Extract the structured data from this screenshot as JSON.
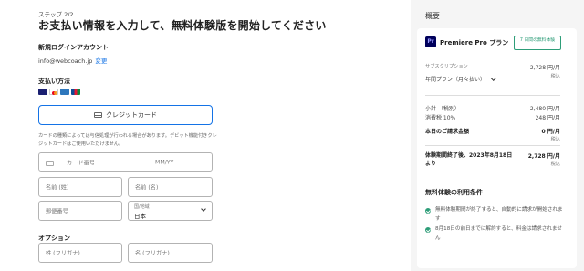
{
  "step": "ステップ 2/2",
  "title": "お支払い情報を入力して、無料体験版を開始してください",
  "account": {
    "label": "新規ログインアカウント",
    "email": "info@webcoach.jp",
    "change": "変更"
  },
  "payment": {
    "label": "支払い方法",
    "card_icons": [
      {
        "name": "visa-icon",
        "color": "#1a1f71"
      },
      {
        "name": "mastercard-icon",
        "color": "#eb001b"
      },
      {
        "name": "amex-icon",
        "color": "#2e77bc"
      },
      {
        "name": "jcb-icon",
        "color": "#0b8a3e"
      }
    ],
    "credit_card_button": "クレジットカード",
    "note": "カードの種類によっては与信処理が行われる場合があります。デビット機能付きクレジットカードはご使用いただけません。",
    "card_number_placeholder": "カード番号",
    "expiry_placeholder": "MM/YY",
    "last_name_placeholder": "名前 (姓)",
    "first_name_placeholder": "名前 (名)",
    "postal_placeholder": "郵便番号",
    "country_label": "国/地域",
    "country_value": "日本"
  },
  "options": {
    "label": "オプション",
    "last_kana_placeholder": "姓 (フリガナ)",
    "first_kana_placeholder": "名 (フリガナ)"
  },
  "summary": {
    "title": "概要",
    "product": "Premiere Pro プラン",
    "product_logo": "Pr",
    "trial_badge": "7 日間の無料体験",
    "subscription_label": "サブスクリプション",
    "plan": "年間プラン（月々払い）",
    "price": "2,728 円/月",
    "tax_included": "税込",
    "subtotal_label": "小計 （税別）",
    "subtotal_value": "2,480 円/月",
    "tax_label": "消費税 10%",
    "tax_value": "248 円/月",
    "today_label": "本日のご請求金額",
    "today_value": "0 円/月",
    "today_tax": "税込",
    "after_label": "体験期間終了後、2023年8月18日より",
    "after_value": "2,728 円/月",
    "after_tax": "税込"
  },
  "conditions": {
    "title": "無料体験の利用条件",
    "items": [
      "無料体験期間が終了すると、自動的に請求が開始されます",
      "8月18日の前日までに解約すると、料金は請求されません"
    ]
  },
  "colors": {
    "accent": "#1473e6",
    "success": "#2d9d78",
    "premiere_bg": "#00005b"
  }
}
